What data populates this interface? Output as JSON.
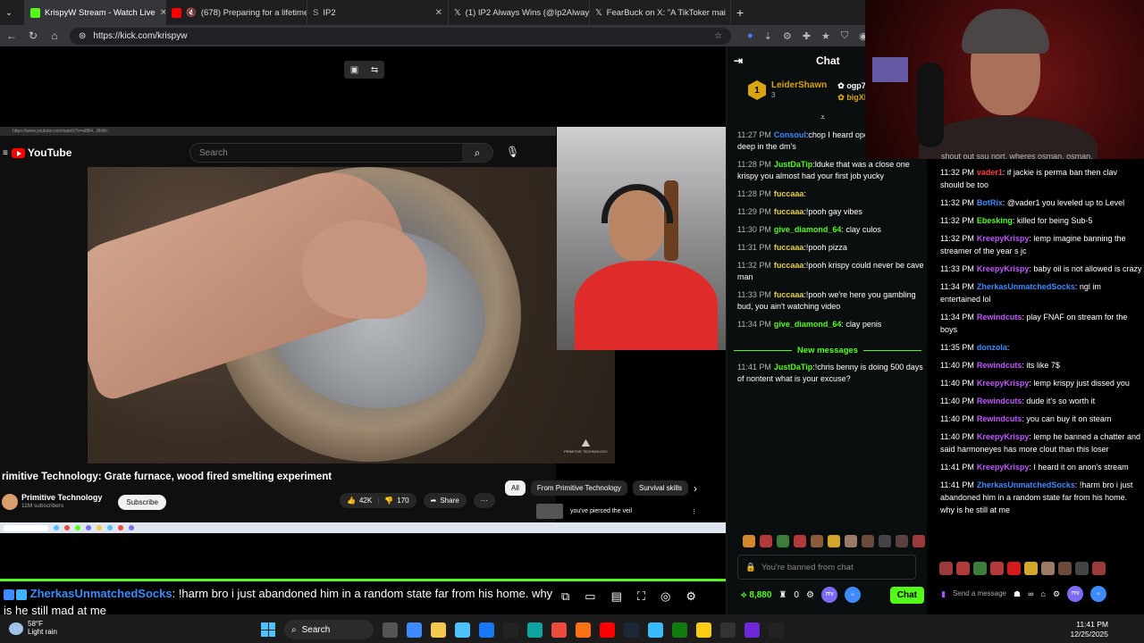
{
  "browser": {
    "tabs": [
      {
        "label": "KrispyW Stream - Watch Live",
        "color": "#53fc18",
        "active": true
      },
      {
        "label": "(678) Preparing for a lifetime",
        "color": "#ff0000"
      },
      {
        "label": "IP2",
        "color": "#888888"
      },
      {
        "label": "(1) IP2 Always Wins (@Ip2AlwaysW",
        "color": "#000000"
      },
      {
        "label": "FearBuck on X: \"A TikToker mai",
        "color": "#000000"
      }
    ],
    "new_tab": "+",
    "url": "https://kick.com/krispyw"
  },
  "youtube": {
    "url_text": "https://www.youtube.com/watch?v=a8B4...8hWc",
    "logo": "YouTube",
    "search_placeholder": "Search",
    "title": "rimitive Technology: Grate furnace, wood fired smelting experiment",
    "channel": "Primitive Technology",
    "subscribers": "11M subscribers",
    "subscribe": "Subscribe",
    "likes": "42K",
    "dislikes": "170",
    "share": "Share",
    "more": "···",
    "chips": [
      "All",
      "From Primitive Technology",
      "Survival skills"
    ],
    "rec_title": "you've pierced the veil",
    "watermark": "PRIMITIVE TECHNOLOGY"
  },
  "overlay": {
    "chat_user": "ZherkasUnmatchedSocks",
    "chat_text": ": !harm bro i just abandoned him in a random state far from his home. why is he still mad at me"
  },
  "kick_chat": {
    "title": "Chat",
    "top_gifter": {
      "rank": "1",
      "name": "LeiderShawn",
      "count": "3"
    },
    "second_gifters": [
      "ogp7",
      "bigXb"
    ],
    "messages": [
      {
        "time": "11:27 PM",
        "user": "Consoul",
        "color": "#3d8bfd",
        "text": ":chop I heard open to him being deep in the dm's"
      },
      {
        "time": "11:28 PM",
        "user": "JustDaTip",
        "color": "#53fc18",
        "text": ":lduke that was a close one krispy you almost had your first job yucky"
      },
      {
        "time": "11:28 PM",
        "user": "fuccaaa",
        "color": "#e6d04a",
        "text": ":"
      },
      {
        "time": "11:29 PM",
        "user": "fuccaaa",
        "color": "#e6d04a",
        "text": ":!pooh gay vibes"
      },
      {
        "time": "11:30 PM",
        "user": "give_diamond_64",
        "color": "#53fc18",
        "text": ": clay culos"
      },
      {
        "time": "11:31 PM",
        "user": "fuccaaa",
        "color": "#e6d04a",
        "text": ":!pooh pizza"
      },
      {
        "time": "11:32 PM",
        "user": "fuccaaa",
        "color": "#e6d04a",
        "text": ":!pooh krispy could never be cave man"
      },
      {
        "time": "11:33 PM",
        "user": "fuccaaa",
        "color": "#e6d04a",
        "text": ":!pooh we're here you gambling bud, you ain't watching video"
      },
      {
        "time": "11:34 PM",
        "user": "give_diamond_64",
        "color": "#53fc18",
        "text": ": clay penis"
      }
    ],
    "new_messages": "New messages",
    "after_messages": [
      {
        "time": "11:41 PM",
        "user": "JustDaTip",
        "color": "#53fc18",
        "text": ":!chris benny is doing 500 days of nontent what is your excuse?"
      }
    ],
    "banned_placeholder": "You're banned from chat",
    "points": "8,880",
    "zero": "0",
    "chat_button": "Chat"
  },
  "right_chat": {
    "top_partial": "shout out ssu nort. wheres osman. osman.",
    "messages": [
      {
        "time": "11:32 PM",
        "user": "vader1",
        "color": "#ff3b3b",
        "text": ": if jackie is perma ban then clav should be too"
      },
      {
        "time": "11:32 PM",
        "user": "BotRix",
        "color": "#3d8bfd",
        "text": ": @vader1 you leveled up to Level"
      },
      {
        "time": "11:32 PM",
        "user": "Ebesking",
        "color": "#53fc18",
        "text": ": killed for being Sub-5"
      },
      {
        "time": "11:32 PM",
        "user": "KreepyKrispy",
        "color": "#c057ff",
        "text": ": lemp imagine banning the streamer of the year s jc"
      },
      {
        "time": "11:33 PM",
        "user": "KreepyKrispy",
        "color": "#c057ff",
        "text": ": baby oil is not allowed is crazy"
      },
      {
        "time": "11:34 PM",
        "user": "ZherkasUnmatchedSocks",
        "color": "#3d8bfd",
        "text": ": ngl im entertained lol"
      },
      {
        "time": "11:34 PM",
        "user": "Rewindcuts",
        "color": "#c057ff",
        "text": ": play FNAF on stream for the boys"
      },
      {
        "time": "11:35 PM",
        "user": "donzola",
        "color": "#3d8bfd",
        "text": ":"
      },
      {
        "time": "11:40 PM",
        "user": "Rewindcuts",
        "color": "#c057ff",
        "text": ": its like 7$"
      },
      {
        "time": "11:40 PM",
        "user": "KreepyKrispy",
        "color": "#c057ff",
        "text": ": lemp krispy just dissed you"
      },
      {
        "time": "11:40 PM",
        "user": "Rewindcuts",
        "color": "#c057ff",
        "text": ": dude it's so worth it"
      },
      {
        "time": "11:40 PM",
        "user": "Rewindcuts",
        "color": "#c057ff",
        "text": ": you can buy it on steam"
      },
      {
        "time": "11:40 PM",
        "user": "KreepyKrispy",
        "color": "#c057ff",
        "text": ": lemp he banned a chatter and said harmoneyes has more clout than this loser"
      },
      {
        "time": "11:41 PM",
        "user": "KreepyKrispy",
        "color": "#c057ff",
        "text": ": I heard it on anon's stream"
      },
      {
        "time": "11:41 PM",
        "user": "ZherkasUnmatchedSocks",
        "color": "#3d8bfd",
        "text": ": !harm bro i just abandoned him in a random state far from his home. why is he still at me"
      }
    ],
    "send_placeholder": "Send a message"
  },
  "taskbar": {
    "temp": "58°F",
    "weather": "Light rain",
    "search": "Search",
    "time": "11:41 PM",
    "date": "12/25/2025"
  }
}
